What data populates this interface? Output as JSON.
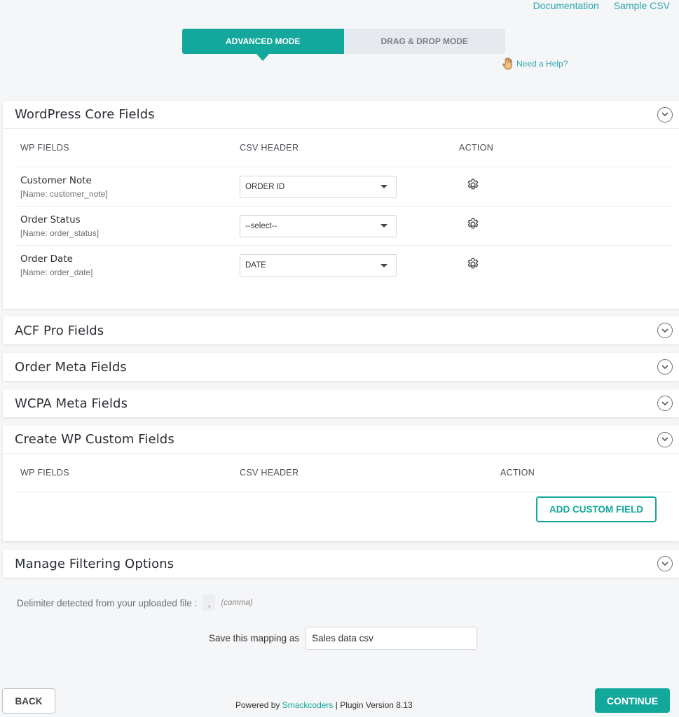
{
  "top_links": {
    "documentation": "Documentation",
    "sample_csv": "Sample CSV"
  },
  "modes": {
    "advanced": "ADVANCED MODE",
    "drag_drop": "DRAG & DROP MODE"
  },
  "help": {
    "label": "Need a Help?"
  },
  "core_panel": {
    "title": "WordPress Core Fields",
    "headers": {
      "wp_fields": "WP FIELDS",
      "csv_header": "CSV HEADER",
      "action": "ACTION"
    },
    "rows": [
      {
        "label": "Customer Note",
        "name": "[Name: customer_note]",
        "selected": "ORDER ID"
      },
      {
        "label": "Order Status",
        "name": "[Name: order_status]",
        "selected": "--select--"
      },
      {
        "label": "Order Date",
        "name": "[Name: order_date]",
        "selected": "DATE"
      }
    ]
  },
  "collapsed_panels": {
    "acf": "ACF Pro Fields",
    "order_meta": "Order Meta Fields",
    "wcpa": "WCPA Meta Fields"
  },
  "custom_panel": {
    "title": "Create WP Custom Fields",
    "headers": {
      "wp_fields": "WP FIELDS",
      "csv_header": "CSV HEADER",
      "action": "ACTION"
    },
    "add_button": "ADD CUSTOM FIELD"
  },
  "filter_panel": {
    "title": "Manage Filtering Options"
  },
  "delimiter": {
    "text": "Delimiter detected from your uploaded file :",
    "value": ",",
    "note": "(comma)"
  },
  "save_mapping": {
    "label": "Save this mapping as",
    "value": "Sales data csv"
  },
  "footer": {
    "prefix": "Powered by",
    "brand": "Smackcoders",
    "suffix": "| Plugin Version 8.13"
  },
  "buttons": {
    "back": "BACK",
    "continue": "CONTINUE"
  },
  "colors": {
    "accent": "#14a89c",
    "link": "#2ea7b0"
  }
}
